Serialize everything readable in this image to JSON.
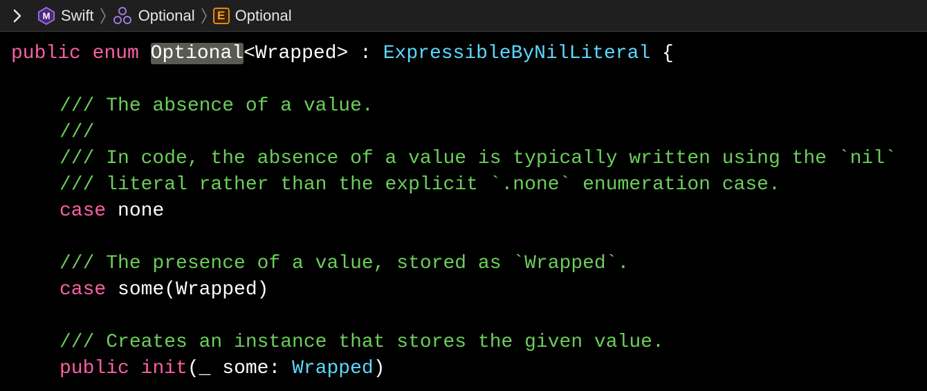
{
  "breadcrumb": {
    "items": [
      {
        "icon": "module-icon",
        "badge": "M",
        "label": "Swift"
      },
      {
        "icon": "namespace-icon",
        "label": "Optional"
      },
      {
        "icon": "enum-icon",
        "badge": "E",
        "label": "Optional"
      }
    ]
  },
  "colors": {
    "keyword": "#fc5fa3",
    "type": "#5dd8ff",
    "comment": "#6bce5a",
    "plain": "#ffffff",
    "highlight": "#5a5a52"
  },
  "code": {
    "line1": {
      "kw_public": "public",
      "kw_enum": "enum",
      "name": "Optional",
      "generic": "<Wrapped> : ",
      "protocol": "ExpressibleByNilLiteral",
      "brace": " {"
    },
    "comment1": "/// The absence of a value.",
    "comment2": "///",
    "comment3": "/// In code, the absence of a value is typically written using the `nil`",
    "comment4": "/// literal rather than the explicit `.none` enumeration case.",
    "case_none": {
      "kw": "case",
      "name": "none"
    },
    "comment5": "/// The presence of a value, stored as `Wrapped`.",
    "case_some": {
      "kw": "case",
      "name": "some(Wrapped)"
    },
    "comment6": "/// Creates an instance that stores the given value.",
    "init_line": {
      "kw_public": "public",
      "kw_init": "init",
      "params": "(_ some: ",
      "type": "Wrapped",
      "close": ")"
    }
  }
}
